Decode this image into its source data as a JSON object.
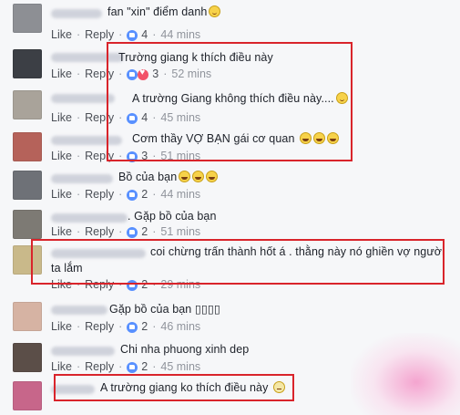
{
  "comments": [
    {
      "text": "fan \"xin\" điểm danh",
      "emoji": "smile",
      "count": "4",
      "time": "44 mins",
      "reaction": "like"
    },
    {
      "text": "Trường giang k thích điều này",
      "emoji": "",
      "count": "3",
      "time": "52 mins",
      "reaction": "heart"
    },
    {
      "text": "A trường Giang không thích điều này....",
      "emoji": "smile",
      "count": "4",
      "time": "45 mins",
      "reaction": "like"
    },
    {
      "text": "Cơm thầy VỢ BẠN gái cơ quan",
      "emoji": "laugh3",
      "count": "3",
      "time": "51 mins",
      "reaction": "like"
    },
    {
      "text": "Bồ của bạn",
      "emoji": "laugh3",
      "count": "2",
      "time": "44 mins",
      "reaction": "like"
    },
    {
      "text": ". Gặp bồ của bạn",
      "emoji": "",
      "count": "2",
      "time": "51 mins",
      "reaction": "like"
    },
    {
      "text": "coi chừng trấn thành hốt á . thằng này nó ghiền vợ người",
      "text2": "ta lắm",
      "emoji": "",
      "count": "2",
      "time": "29 mins",
      "reaction": "like"
    },
    {
      "text": "Gặp bồ của bạn ▯▯▯▯",
      "emoji": "",
      "count": "2",
      "time": "46 mins",
      "reaction": "like"
    },
    {
      "text": "Chi nha phuong xinh dep",
      "emoji": "",
      "count": "2",
      "time": "45 mins",
      "reaction": "like"
    },
    {
      "text": "A trường giang ko thích điều này",
      "emoji": "neutral",
      "count": "",
      "time": "",
      "reaction": ""
    }
  ],
  "actions": {
    "like": "Like",
    "reply": "Reply",
    "separator": "·"
  },
  "colors": {
    "highlight_box": "#d9242b",
    "like_badge": "#5890ff",
    "heart_badge": "#f25268"
  }
}
